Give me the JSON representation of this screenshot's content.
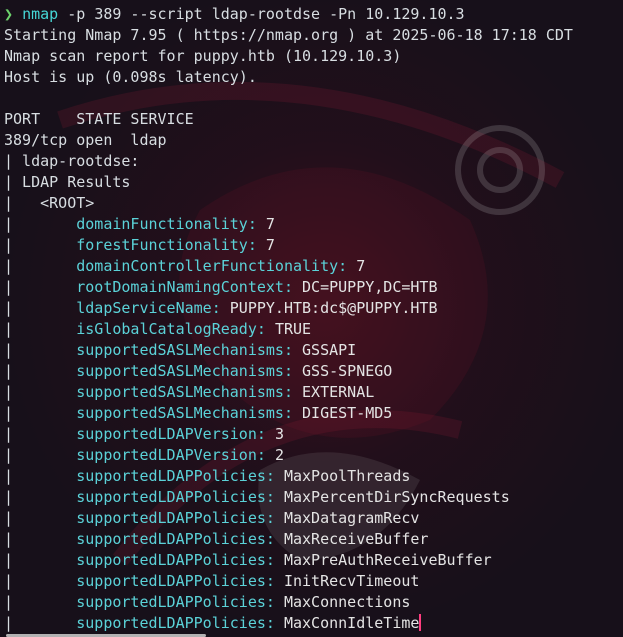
{
  "terminal": {
    "prompt": {
      "symbol": "❯",
      "command": "nmap",
      "arg1": " -p ",
      "arg2": "389",
      "arg3": " --script ",
      "arg4": "ldap-rootdse",
      "arg5": " -Pn ",
      "arg6": "10.129.10.3"
    },
    "header_lines": [
      "Starting Nmap 7.95 ( https://nmap.org ) at 2025-06-18 17:18 CDT",
      "Nmap scan report for puppy.htb (10.129.10.3)",
      "Host is up (0.098s latency).",
      "",
      "PORT    STATE SERVICE",
      "389/tcp open  ldap",
      "| ldap-rootdse:",
      "| LDAP Results",
      "|   <ROOT>"
    ],
    "entries": [
      {
        "key": "domainFunctionality",
        "value": "7"
      },
      {
        "key": "forestFunctionality",
        "value": "7"
      },
      {
        "key": "domainControllerFunctionality",
        "value": "7"
      },
      {
        "key": "rootDomainNamingContext",
        "value": "DC=PUPPY,DC=HTB"
      },
      {
        "key": "ldapServiceName",
        "value": "PUPPY.HTB:dc$@PUPPY.HTB"
      },
      {
        "key": "isGlobalCatalogReady",
        "value": "TRUE"
      },
      {
        "key": "supportedSASLMechanisms",
        "value": "GSSAPI"
      },
      {
        "key": "supportedSASLMechanisms",
        "value": "GSS-SPNEGO"
      },
      {
        "key": "supportedSASLMechanisms",
        "value": "EXTERNAL"
      },
      {
        "key": "supportedSASLMechanisms",
        "value": "DIGEST-MD5"
      },
      {
        "key": "supportedLDAPVersion",
        "value": "3"
      },
      {
        "key": "supportedLDAPVersion",
        "value": "2"
      },
      {
        "key": "supportedLDAPPolicies",
        "value": "MaxPoolThreads"
      },
      {
        "key": "supportedLDAPPolicies",
        "value": "MaxPercentDirSyncRequests"
      },
      {
        "key": "supportedLDAPPolicies",
        "value": "MaxDatagramRecv"
      },
      {
        "key": "supportedLDAPPolicies",
        "value": "MaxReceiveBuffer"
      },
      {
        "key": "supportedLDAPPolicies",
        "value": "MaxPreAuthReceiveBuffer"
      },
      {
        "key": "supportedLDAPPolicies",
        "value": "InitRecvTimeout"
      },
      {
        "key": "supportedLDAPPolicies",
        "value": "MaxConnections"
      },
      {
        "key": "supportedLDAPPolicies",
        "value": "MaxConnIdleTime"
      }
    ],
    "colors": {
      "background": "#17101a",
      "cursor": "#ff3d7f",
      "command": "#46d6d6",
      "prompt_symbol": "#6dd46d"
    }
  }
}
